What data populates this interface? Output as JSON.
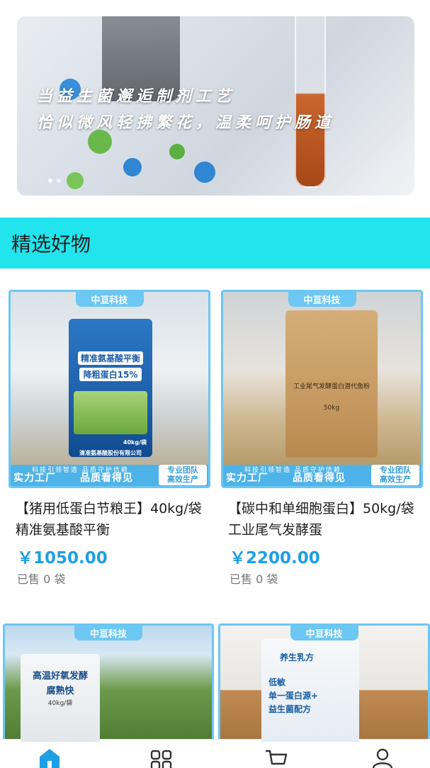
{
  "banner": {
    "line1": "当益生菌邂逅制剂工艺",
    "line2": "恰似微风轻拂繁花，温柔呵护肠道"
  },
  "section": {
    "title": "精选好物"
  },
  "products": [
    {
      "brand": "中亘科技",
      "slogan": "科技引领智造 品质守护信赖",
      "footer_left": "实力工厂",
      "footer_mid": "品质看得见",
      "footer_right_1": "专业团队",
      "footer_right_2": "高效生产",
      "bag_line1": "精准氨基酸平衡",
      "bag_line2": "降粗蛋白15%",
      "bag_weight": "40kg/袋",
      "bag_company": "清准氨基酸股份有限公司",
      "name": "【猪用低蛋白节粮王】40kg/袋 精准氨基酸平衡",
      "price": "￥1050.00",
      "sold": "已售 0 袋"
    },
    {
      "brand": "中亘科技",
      "slogan": "科技引领智造 品质守护信赖",
      "footer_left": "实力工厂",
      "footer_mid": "品质看得见",
      "footer_right_1": "专业团队",
      "footer_right_2": "高效生产",
      "bag_line1": "工业尾气发酵蛋白潜代鱼粉",
      "bag_weight": "50kg",
      "name": "【碳中和单细胞蛋白】50kg/袋 工业尾气发酵蛋",
      "price": "￥2200.00",
      "sold": "已售 0 袋"
    },
    {
      "brand": "中亘科技",
      "bag_line1": "高温好氧发酵",
      "bag_line2": "腐熟快",
      "bag_weight": "40kg/袋"
    },
    {
      "brand": "中亘科技",
      "bag_brand": "养生乳方",
      "bag_line1": "低敏",
      "bag_line2": "单一蛋白源+",
      "bag_line3": "益生菌配方"
    }
  ],
  "tabbar": {
    "icons": [
      "home-icon",
      "category-grid-icon",
      "cart-icon",
      "user-icon"
    ],
    "active_color": "#1f9fe3",
    "inactive_color": "#333333"
  }
}
